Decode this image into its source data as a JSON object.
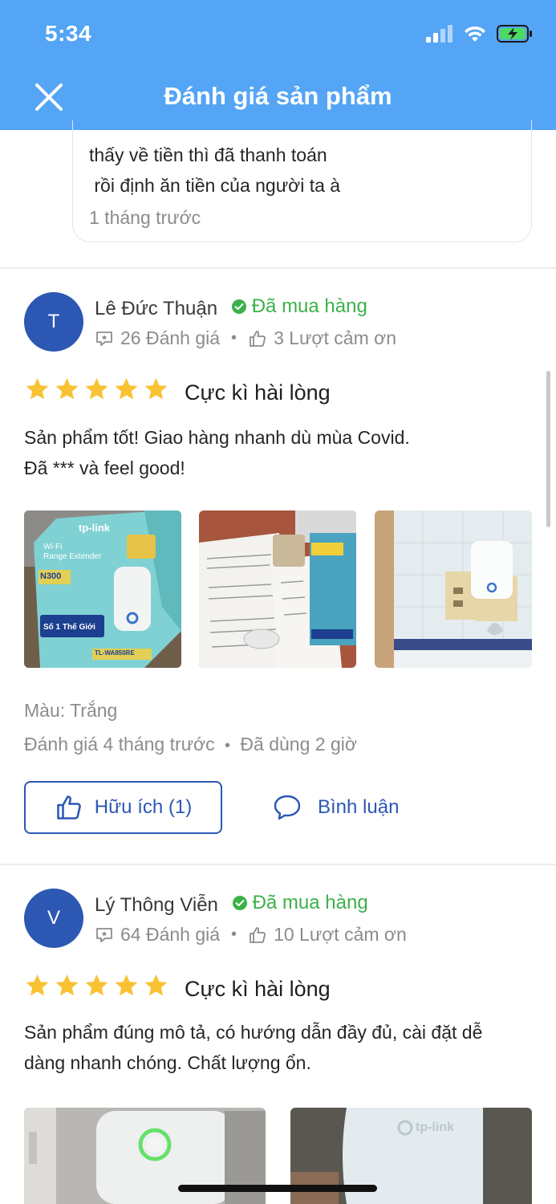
{
  "status_bar": {
    "time": "5:34"
  },
  "header": {
    "title": "Đánh giá sản phẩm"
  },
  "prev_comment": {
    "lines": [
      "thấy về tiền thì đã thanh toán",
      " rồi định ăn tiền của người ta à"
    ],
    "time": "1 tháng trước"
  },
  "reviews": [
    {
      "avatar_letter": "T",
      "name": "Lê Đức Thuận",
      "purchased_label": "Đã mua hàng",
      "review_count": "26 Đánh giá",
      "thanks_count": "3 Lượt cảm ơn",
      "rating_label": "Cực kì hài lòng",
      "body_lines": [
        "Sản phẩm tốt! Giao hàng nhanh dù mùa Covid.",
        "Đã *** và feel good!"
      ],
      "color_attr": "Màu: Trắng",
      "review_time": "Đánh giá 4 tháng trước",
      "used_time": "Đã dùng 2 giờ",
      "helpful_label": "Hữu ích (1)",
      "comment_label": "Bình luận",
      "photos": [
        {
          "box_brand": "tp-link",
          "box_line1": "Wi-Fi",
          "box_line2": "Range Extender",
          "box_model": "N300",
          "box_badge": "Số 1 Thế Giới",
          "box_sku": "TL-WA850RE"
        },
        {
          "caption": "document-photo"
        },
        {
          "caption": "wall-outlet-photo"
        }
      ]
    },
    {
      "avatar_letter": "V",
      "name": "Lý Thông Viễn",
      "purchased_label": "Đã mua hàng",
      "review_count": "64 Đánh giá",
      "thanks_count": "10 Lượt cảm ơn",
      "rating_label": "Cực kì hài lòng",
      "body_lines": [
        "Sản phẩm đúng mô tả, có hướng dẫn đầy đủ, cài đặt dễ",
        "dàng nhanh chóng. Chất lượng ổn."
      ],
      "photo_brand": "tp-link"
    }
  ],
  "colors": {
    "header": "#54a5f5",
    "accent": "#2c57b3",
    "green": "#3cb14a",
    "star": "#f9c233"
  }
}
